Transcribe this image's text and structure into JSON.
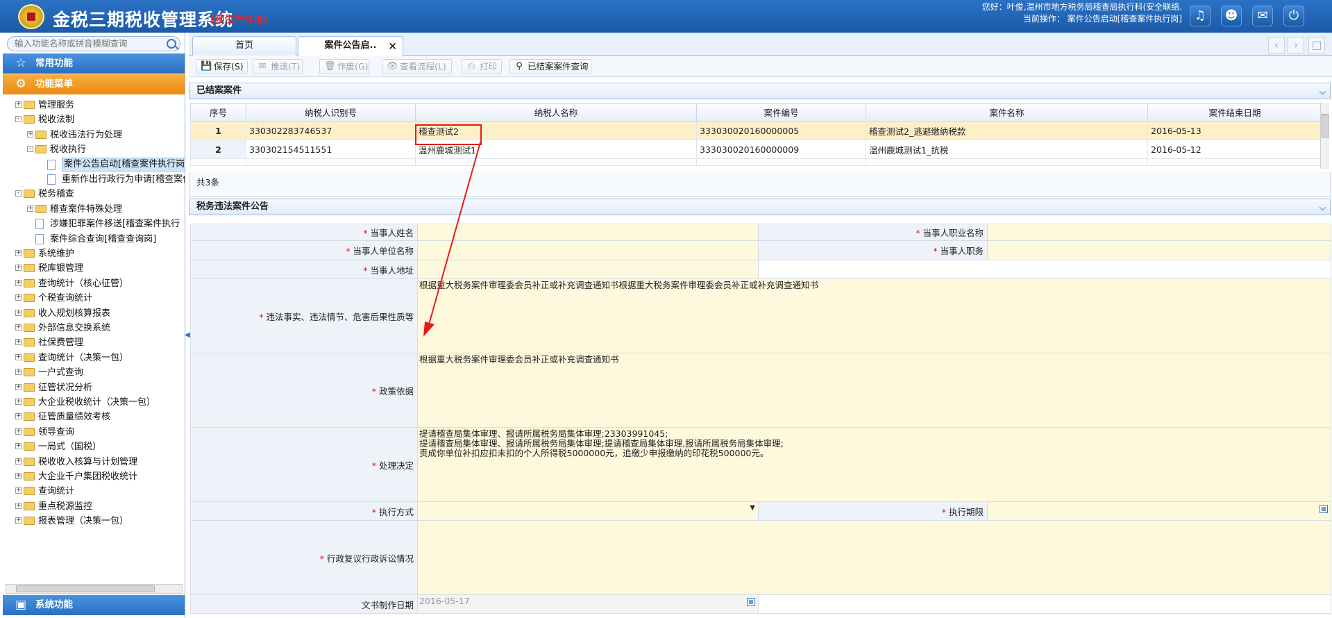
{
  "header": {
    "app_title": "金税三期税收管理系统",
    "env_badge": "(预生产环境)",
    "welcome": "您好：叶俊,温州市地方税务局稽查局执行科(安全联络.",
    "current_op": "当前操作：  案件公告启动[稽查案件执行岗]",
    "icons": [
      "bell-icon",
      "users-icon",
      "chat-icon",
      "power-icon"
    ]
  },
  "sidebar": {
    "search_placeholder": "输入功能名称或拼音模糊查询",
    "common_label": "常用功能",
    "menu_label": "功能菜单",
    "system_label": "系统功能",
    "tree": [
      {
        "label": "管理服务",
        "type": "folder",
        "level": 0,
        "exp": "+"
      },
      {
        "label": "税收法制",
        "type": "folder",
        "level": 0,
        "exp": "-"
      },
      {
        "label": "税收违法行为处理",
        "type": "folder",
        "level": 1,
        "exp": "+"
      },
      {
        "label": "税收执行",
        "type": "folder",
        "level": 1,
        "exp": "-"
      },
      {
        "label": "案件公告启动[稽查案件执行岗]",
        "type": "page",
        "level": 2,
        "sel": true
      },
      {
        "label": "重新作出行政行为申请[稽查案件",
        "type": "page",
        "level": 2
      },
      {
        "label": "税务稽查",
        "type": "folder",
        "level": 0,
        "exp": "-"
      },
      {
        "label": "稽查案件特殊处理",
        "type": "folder",
        "level": 1,
        "exp": "+"
      },
      {
        "label": "涉嫌犯罪案件移送[稽查案件执行",
        "type": "page",
        "level": 1
      },
      {
        "label": "案件综合查询[稽查查询岗]",
        "type": "page",
        "level": 1
      },
      {
        "label": "系统维护",
        "type": "folder",
        "level": 0,
        "exp": "+"
      },
      {
        "label": "税库银管理",
        "type": "folder",
        "level": 0,
        "exp": "+"
      },
      {
        "label": "查询统计（核心征管）",
        "type": "folder",
        "level": 0,
        "exp": "+"
      },
      {
        "label": "个税查询统计",
        "type": "folder",
        "level": 0,
        "exp": "+"
      },
      {
        "label": "收入规划核算报表",
        "type": "folder",
        "level": 0,
        "exp": "+"
      },
      {
        "label": "外部信息交换系统",
        "type": "folder",
        "level": 0,
        "exp": "+"
      },
      {
        "label": "社保费管理",
        "type": "folder",
        "level": 0,
        "exp": "+"
      },
      {
        "label": "查询统计（决策一包）",
        "type": "folder",
        "level": 0,
        "exp": "+"
      },
      {
        "label": "一户式查询",
        "type": "folder",
        "level": 0,
        "exp": "+"
      },
      {
        "label": "征管状况分析",
        "type": "folder",
        "level": 0,
        "exp": "+"
      },
      {
        "label": "大企业税收统计（决策一包）",
        "type": "folder",
        "level": 0,
        "exp": "+"
      },
      {
        "label": "征管质量绩效考核",
        "type": "folder",
        "level": 0,
        "exp": "+"
      },
      {
        "label": "领导查询",
        "type": "folder",
        "level": 0,
        "exp": "+"
      },
      {
        "label": "一局式（国税）",
        "type": "folder",
        "level": 0,
        "exp": "+"
      },
      {
        "label": "税收收入核算与计划管理",
        "type": "folder",
        "level": 0,
        "exp": "+"
      },
      {
        "label": "大企业千户集团税收统计",
        "type": "folder",
        "level": 0,
        "exp": "+"
      },
      {
        "label": "查询统计",
        "type": "folder",
        "level": 0,
        "exp": "+"
      },
      {
        "label": "重点税源监控",
        "type": "folder",
        "level": 0,
        "exp": "+"
      },
      {
        "label": "报表管理（决策一包）",
        "type": "folder",
        "level": 0,
        "exp": "+"
      }
    ]
  },
  "tabs": [
    {
      "label": "首页"
    },
    {
      "label": "案件公告启..",
      "close": "×"
    }
  ],
  "toolbar": {
    "save": "保存(S)",
    "push": "推送(T)",
    "void": "作废(G)",
    "flow": "查看流程(L)",
    "print": "打印",
    "query": "已结案案件查询"
  },
  "closed_cases": {
    "title": "已结案案件",
    "columns": [
      "序号",
      "纳税人识别号",
      "纳税人名称",
      "案件编号",
      "案件名称",
      "案件结束日期"
    ],
    "rows": [
      [
        "1",
        "330302283746537",
        "稽查测试2",
        "333030020160000005",
        "稽查测试2_逃避缴纳税款",
        "2016-05-13"
      ],
      [
        "2",
        "330302154511551",
        "温州鹿城测试1",
        "333030020160000009",
        "温州鹿城测试1_抗税",
        "2016-05-12"
      ]
    ],
    "footer": "共3条"
  },
  "notice": {
    "title": "税务违法案件公告",
    "party_name": "当事人姓名",
    "party_title": "当事人职业名称",
    "party_unit": "当事人单位名称",
    "party_post": "当事人职务",
    "party_addr": "当事人地址",
    "facts_label": "违法事实、违法情节、危害后果性质等",
    "facts_value": "根据重大税务案件审理委会员补正或补充调查通知书根据重大税务案件审理委会员补正或补充调查通知书",
    "policy_label": "政策依据",
    "policy_value": "根据重大税务案件审理委会员补正或补充调查通知书",
    "decision_label": "处理决定",
    "decision_value": "提请稽查局集体审理、报请所属税务局集体审理;23303991045;\n提请稽查局集体审理、报请所属税务局集体审理;提请稽查局集体审理,报请所属税务局集体审理;\n责成你单位补扣应扣未扣的个人所得税5000000元，追缴少申报缴纳的印花税500000元。",
    "exec_method": "执行方式",
    "exec_period": "执行期限",
    "review_label": "行政复议行政诉讼情况",
    "doc_date_label": "文书制作日期",
    "doc_date_value": "2016-05-17"
  }
}
